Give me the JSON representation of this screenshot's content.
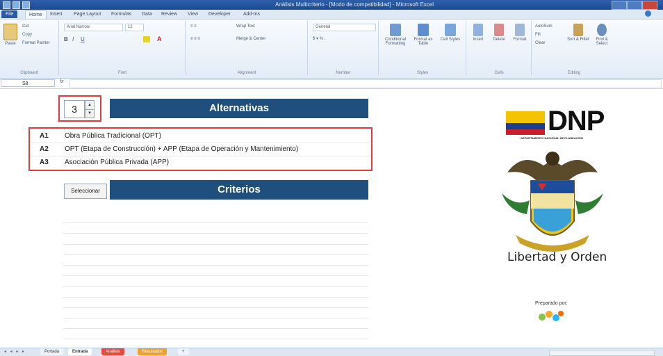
{
  "window": {
    "title": "Análisis Multicriterio - [Modo de compatibilidad] - Microsoft Excel"
  },
  "ribbon_tabs": [
    "File",
    "Home",
    "Insert",
    "Page Layout",
    "Formulas",
    "Data",
    "Review",
    "View",
    "Developer",
    "Add-Ins"
  ],
  "ribbon": {
    "clipboard": {
      "paste": "Paste",
      "cut": "Cut",
      "copy": "Copy",
      "format_painter": "Format Painter",
      "label": "Clipboard"
    },
    "font": {
      "name": "Arial Narrow",
      "size": "12",
      "label": "Font"
    },
    "alignment": {
      "wrap": "Wrap Text",
      "merge": "Merge & Center",
      "label": "Alignment"
    },
    "number": {
      "format": "General",
      "label": "Number"
    },
    "styles": {
      "cond": "Conditional Formatting",
      "table": "Format as Table",
      "cell": "Cell Styles",
      "label": "Styles"
    },
    "cells": {
      "insert": "Insert",
      "delete": "Delete",
      "format": "Format",
      "label": "Cells"
    },
    "editing": {
      "autosum": "AutoSum",
      "fill": "Fill",
      "clear": "Clear",
      "sort": "Sort & Filter",
      "find": "Find & Select",
      "label": "Editing"
    }
  },
  "formula_bar": {
    "name_box": "S8",
    "fx": "fx",
    "value": ""
  },
  "sheet": {
    "spinner_value": "3",
    "alternatives_title": "Alternativas",
    "alternatives": [
      {
        "code": "A1",
        "text": "Obra Pública Tradicional (OPT)"
      },
      {
        "code": "A2",
        "text": "OPT (Etapa de Construcción) + APP (Etapa de Operación y Mantenimiento)"
      },
      {
        "code": "A3",
        "text": "Asociación Pública Privada (APP)"
      }
    ],
    "select_button": "Seleccionar",
    "criteria_title": "Criterios"
  },
  "logo": {
    "dnp": "DNP",
    "dnp_subtitle": "DEPARTAMENTO NACIONAL DE PLANEACIÓN",
    "motto": "Libertad y Orden",
    "prepared_by": "Preparado por:"
  },
  "sheet_tabs": [
    "Portada",
    "Entrada",
    "Análisis",
    "Resultados"
  ],
  "colors": {
    "banner": "#1e4f7d",
    "highlight": "#e03b3f",
    "ribbon_file": "#2a5aa3"
  }
}
